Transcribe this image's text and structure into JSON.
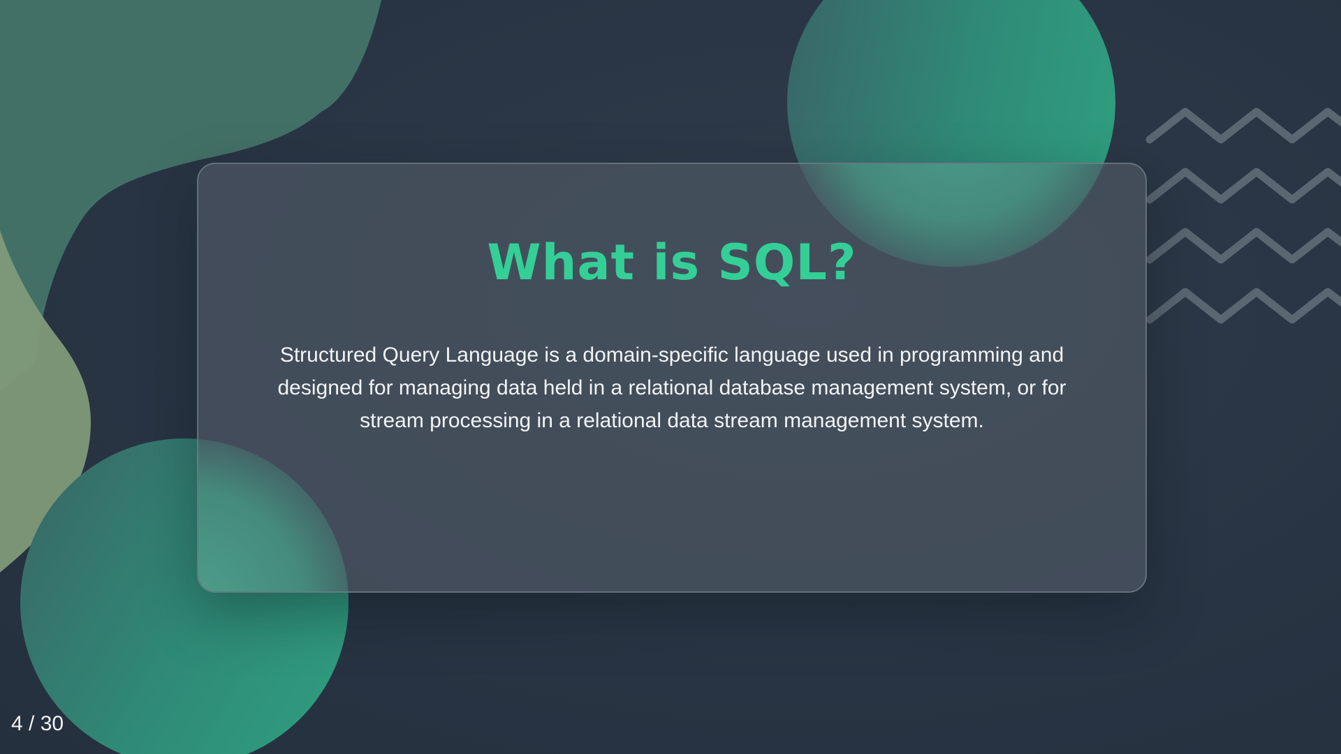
{
  "slide": {
    "title": "What is SQL?",
    "body": "Structured Query Language is a domain-specific language used in programming and designed for managing data held in a relational database management system, or for stream processing in a relational data stream management system."
  },
  "pagination": {
    "indicator": "4 / 30"
  },
  "colors": {
    "background": "#2a3645",
    "accent": "#34cf97",
    "card": "#4c5662"
  }
}
